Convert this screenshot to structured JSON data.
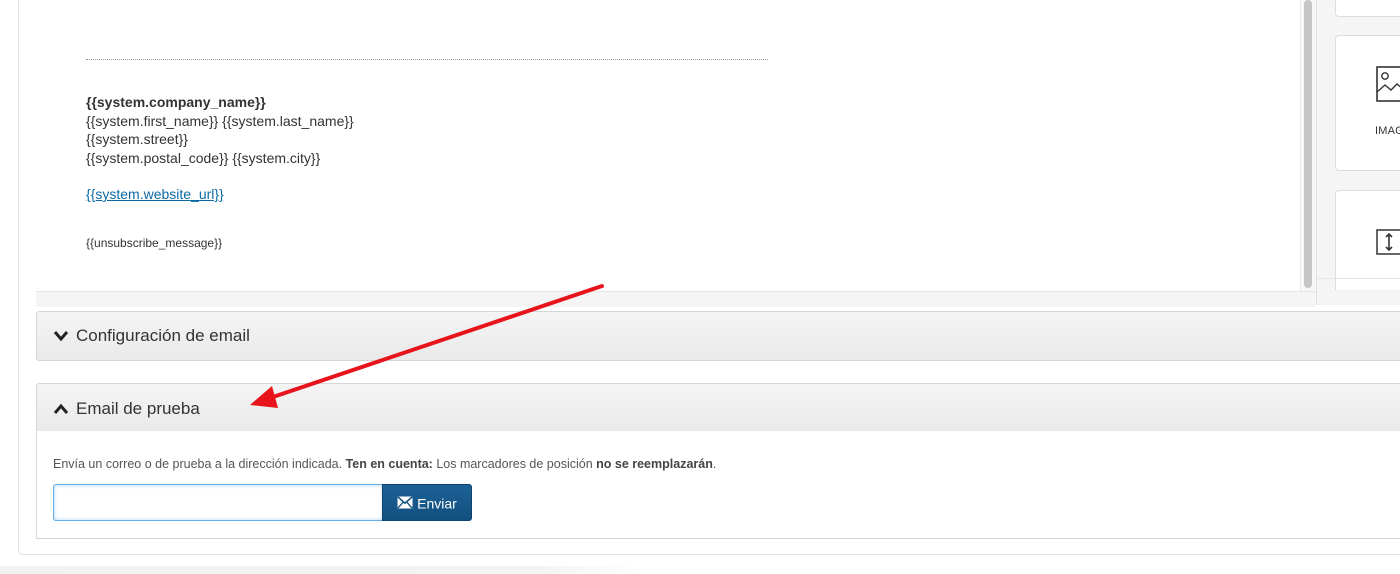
{
  "preview": {
    "signature": {
      "company": "{{system.company_name}}",
      "name": "{{system.first_name}} {{system.last_name}}",
      "street": "{{system.street}}",
      "postal_city": "{{system.postal_code}} {{system.city}}",
      "website": "{{system.website_url}}",
      "unsubscribe": "{{unsubscribe_message}}"
    }
  },
  "blocks_panel": {
    "image_label": "IMAG",
    "icons": [
      "image-icon",
      "vertical-spacer-icon"
    ]
  },
  "accordion": {
    "config": {
      "title": "Configuración de email",
      "icon": "chevron-down-icon"
    },
    "test_email": {
      "title": "Email de prueba",
      "icon": "chevron-up-icon",
      "help": {
        "part1": "Envía un correo o de prueba a la dirección indicada. ",
        "bold1": "Ten en cuenta:",
        "part2": " Los marcadores de posición ",
        "bold2": "no se reemplazarán",
        "part3": "."
      },
      "input": {
        "value": "",
        "placeholder": ""
      },
      "send_button": {
        "label": "Enviar",
        "icon": "envelope-icon"
      }
    }
  },
  "annotation": {
    "arrow_color": "#e8141b"
  },
  "colors": {
    "link": "#0b6aa6",
    "primary_button": "#1a5a8c",
    "input_focus": "#66afe9"
  }
}
